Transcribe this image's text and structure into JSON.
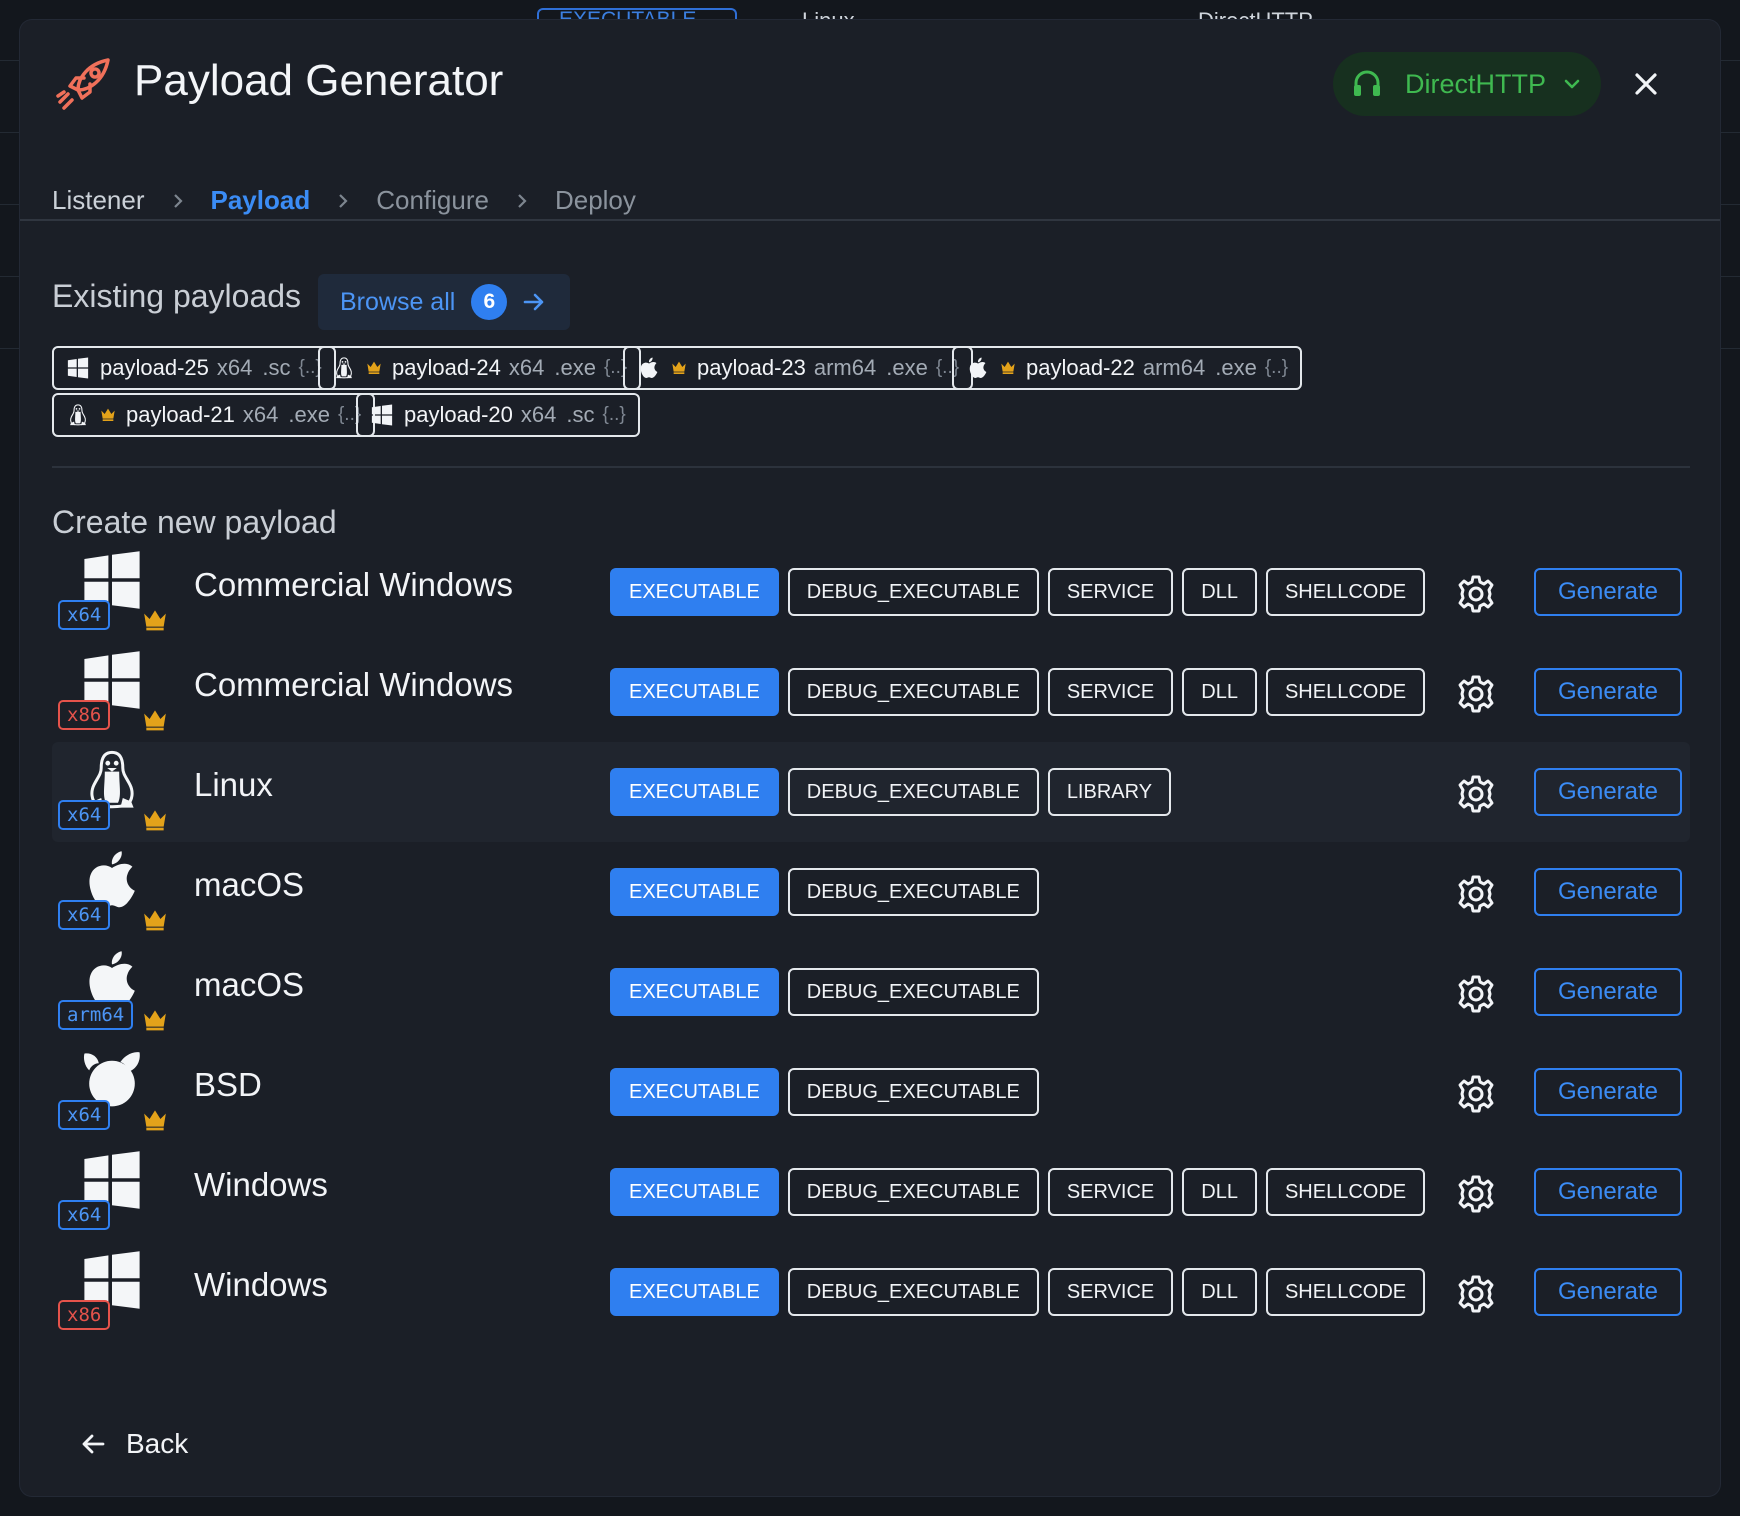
{
  "background": {
    "tab_partial_1": "EXECUTABLE",
    "tab_partial_2": "Linux",
    "tab_partial_3": "DirectHTTP"
  },
  "header": {
    "title": "Payload Generator",
    "icon": "rocket-icon",
    "listener_selector": "DirectHTTP",
    "close_icon": "close-icon"
  },
  "breadcrumb": {
    "steps": [
      "Listener",
      "Payload",
      "Configure",
      "Deploy"
    ],
    "active": "Payload"
  },
  "existing": {
    "title": "Existing payloads",
    "browse_label": "Browse all",
    "browse_count": "6",
    "payloads": [
      {
        "os_icon": "windows-icon",
        "premium": false,
        "name": "payload-25",
        "arch": "x64",
        "ext": ".sc",
        "json": "{..}"
      },
      {
        "os_icon": "linux-icon",
        "premium": true,
        "name": "payload-24",
        "arch": "x64",
        "ext": ".exe",
        "json": "{..}"
      },
      {
        "os_icon": "apple-icon",
        "premium": true,
        "name": "payload-23",
        "arch": "arm64",
        "ext": ".exe",
        "json": "{..}"
      },
      {
        "os_icon": "apple-icon",
        "premium": true,
        "name": "payload-22",
        "arch": "arm64",
        "ext": ".exe",
        "json": "{..}"
      },
      {
        "os_icon": "linux-icon",
        "premium": true,
        "name": "payload-21",
        "arch": "x64",
        "ext": ".exe",
        "json": "{..}"
      },
      {
        "os_icon": "windows-icon",
        "premium": false,
        "name": "payload-20",
        "arch": "x64",
        "ext": ".sc",
        "json": "{..}"
      }
    ]
  },
  "create": {
    "title": "Create new payload",
    "generate_label": "Generate",
    "rows": [
      {
        "os_icon": "windows-icon",
        "arch": "x64",
        "premium": true,
        "name": "Commercial Windows",
        "types": [
          "EXECUTABLE",
          "DEBUG_EXECUTABLE",
          "SERVICE",
          "DLL",
          "SHELLCODE"
        ],
        "selected": "EXECUTABLE"
      },
      {
        "os_icon": "windows-icon",
        "arch": "x86",
        "premium": true,
        "name": "Commercial Windows",
        "types": [
          "EXECUTABLE",
          "DEBUG_EXECUTABLE",
          "SERVICE",
          "DLL",
          "SHELLCODE"
        ],
        "selected": "EXECUTABLE"
      },
      {
        "os_icon": "linux-icon",
        "arch": "x64",
        "premium": true,
        "name": "Linux",
        "types": [
          "EXECUTABLE",
          "DEBUG_EXECUTABLE",
          "LIBRARY"
        ],
        "selected": "EXECUTABLE",
        "hovered": true
      },
      {
        "os_icon": "apple-icon",
        "arch": "x64",
        "premium": true,
        "name": "macOS",
        "types": [
          "EXECUTABLE",
          "DEBUG_EXECUTABLE"
        ],
        "selected": "EXECUTABLE"
      },
      {
        "os_icon": "apple-icon",
        "arch": "arm64",
        "premium": true,
        "name": "macOS",
        "types": [
          "EXECUTABLE",
          "DEBUG_EXECUTABLE"
        ],
        "selected": "EXECUTABLE"
      },
      {
        "os_icon": "bsd-icon",
        "arch": "x64",
        "premium": true,
        "name": "BSD",
        "types": [
          "EXECUTABLE",
          "DEBUG_EXECUTABLE"
        ],
        "selected": "EXECUTABLE"
      },
      {
        "os_icon": "windows-icon",
        "arch": "x64",
        "premium": false,
        "name": "Windows",
        "types": [
          "EXECUTABLE",
          "DEBUG_EXECUTABLE",
          "SERVICE",
          "DLL",
          "SHELLCODE"
        ],
        "selected": "EXECUTABLE"
      },
      {
        "os_icon": "windows-icon",
        "arch": "x86",
        "premium": false,
        "name": "Windows",
        "types": [
          "EXECUTABLE",
          "DEBUG_EXECUTABLE",
          "SERVICE",
          "DLL",
          "SHELLCODE"
        ],
        "selected": "EXECUTABLE"
      }
    ]
  },
  "footer": {
    "back_label": "Back"
  },
  "colors": {
    "accent": "#2f7ff0",
    "listener_green": "#3fb950",
    "crown_gold": "#e3a21a",
    "x86_red": "#e5534b",
    "rocket_orange": "#f0705a"
  }
}
